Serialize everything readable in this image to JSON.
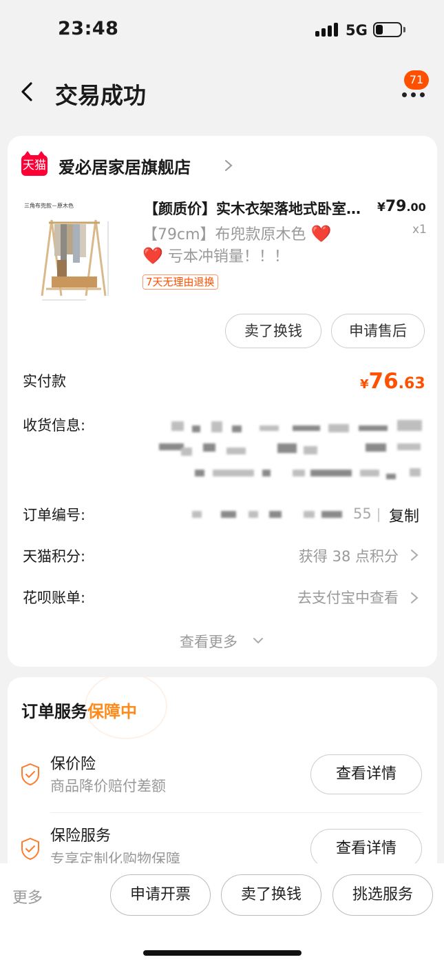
{
  "status_bar": {
    "time": "23:48",
    "network": "5G",
    "battery_level": 0.3
  },
  "header": {
    "title": "交易成功",
    "message_count": "71"
  },
  "shop": {
    "logo_text": "天猫",
    "name": "爱必居家居旗舰店"
  },
  "product": {
    "image_caption": "三角布兜款－原木色",
    "title": "【颜质价】实木衣架落地式卧室挂衣架",
    "spec_line1": "【79cm】布兜款原木色",
    "spec_line2": "亏本冲销量！！！",
    "heart": "❤️",
    "return_tag": "7天无理由退换",
    "price_symbol": "¥",
    "price_int": "79",
    "price_dec": ".00",
    "qty": "x1",
    "actions": [
      "卖了换钱",
      "申请售后"
    ]
  },
  "order_info": {
    "paid_label": "实付款",
    "paid_symbol": "¥",
    "paid_int": "76",
    "paid_dec": ".63",
    "address_label": "收货信息:",
    "order_no_label": "订单编号:",
    "order_no_tail": "55",
    "copy_label": "复制",
    "points_label": "天猫积分:",
    "points_value": "获得 38 点积分",
    "huabei_label": "花呗账单:",
    "huabei_value": "去支付宝中查看",
    "see_more": "查看更多"
  },
  "service": {
    "title_prefix": "订单服务",
    "title_highlight": "保障中",
    "items": [
      {
        "name": "保价险",
        "desc": "商品降价赔付差额",
        "button": "查看详情"
      },
      {
        "name": "保险服务",
        "desc": "专享定制化购物保障",
        "button": "查看详情"
      }
    ]
  },
  "bottom_bar": {
    "more": "更多",
    "buttons": [
      "申请开票",
      "卖了换钱",
      "挑选服务"
    ]
  },
  "colors": {
    "accent": "#ff5000",
    "tmall_red": "#ff0036",
    "service_orange": "#ff8a1a"
  }
}
